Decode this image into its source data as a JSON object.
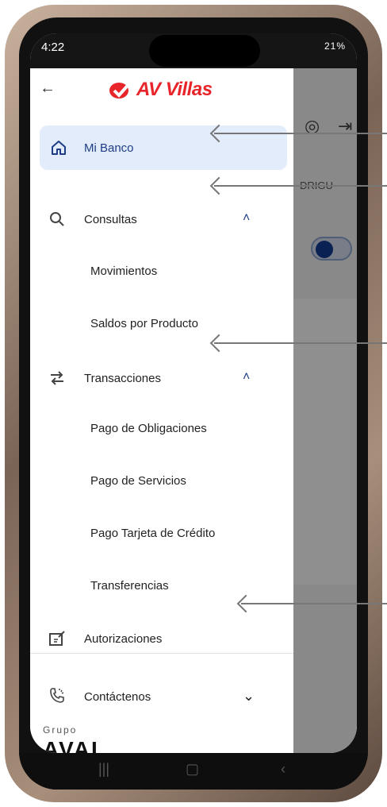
{
  "status_bar": {
    "time": "4:22",
    "right": "21%"
  },
  "drawer": {
    "logo_text": "AV Villas",
    "items": [
      {
        "label": "Mi Banco",
        "icon": "home-icon",
        "selected": true
      },
      {
        "label": "Consultas",
        "icon": "search-icon",
        "expanded": true
      },
      {
        "label": "Transacciones",
        "icon": "transfer-icon",
        "expanded": true
      },
      {
        "label": "Autorizaciones",
        "icon": "edit-icon"
      }
    ],
    "consultas_sub": [
      "Movimientos",
      "Saldos por Producto"
    ],
    "transacciones_sub": [
      "Pago de Obligaciones",
      "Pago de Servicios",
      "Pago Tarjeta de Crédito",
      "Transferencias"
    ],
    "contact": {
      "label": "Contáctenos"
    },
    "footer": {
      "grupo": "Grupo",
      "aval": "AVAL"
    }
  },
  "background_app": {
    "partial_text": "DRIGU"
  },
  "colors": {
    "accent": "#1f3d86",
    "brand_red": "#e8252a",
    "selected_bg": "#e3ecfb"
  }
}
